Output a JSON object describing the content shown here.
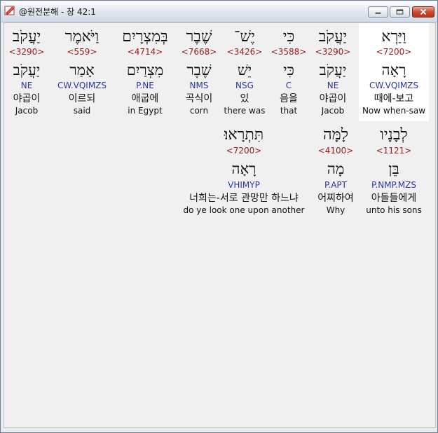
{
  "window": {
    "title": "@원전분해 - 창 42:1",
    "controls": [
      "minimize-icon",
      "maximize-icon",
      "close-icon"
    ]
  },
  "colors": {
    "strong": "#9b1a1a",
    "morph": "#2a36a8",
    "selected_bg": "#ffffff"
  },
  "rows": [
    {
      "words": [
        {
          "hebrew": "וַיַּרְא",
          "strong": "<7200>",
          "root": "רָאָה",
          "morph": "CW.VQIMZS",
          "korean": "때에-보고",
          "english": "Now when-saw",
          "selected": true
        },
        {
          "hebrew": "יַעֲקֹב",
          "strong": "<3290>",
          "root": "יַעֲקֹב",
          "morph": "NE",
          "korean": "야곱이",
          "english": "Jacob"
        },
        {
          "hebrew": "כִּי",
          "strong": "<3588>",
          "root": "כִּי",
          "morph": "C",
          "korean": "음을",
          "english": "that"
        },
        {
          "hebrew": "יֶשׁ־",
          "strong": "<3426>",
          "root": "יֵשׁ",
          "morph": "NSG",
          "korean": "있",
          "english": "there was"
        },
        {
          "hebrew": "שֶׁבֶר",
          "strong": "<7668>",
          "root": "שֶׁבֶר",
          "morph": "NMS",
          "korean": "곡식이",
          "english": "corn"
        },
        {
          "hebrew": "בְּמִצְרָיִם",
          "strong": "<4714>",
          "root": "מִצְרַיִם",
          "morph": "P.NE",
          "korean": "애굽에",
          "english": "in Egypt"
        },
        {
          "hebrew": "וַיֹּאמֶר",
          "strong": "<559>",
          "root": "אָמַר",
          "morph": "CW.VQIMZS",
          "korean": "이르되",
          "english": "said"
        },
        {
          "hebrew": "יַעֲקֹב",
          "strong": "<3290>",
          "root": "יַעֲקֹב",
          "morph": "NE",
          "korean": "야곱이",
          "english": "Jacob"
        }
      ]
    },
    {
      "words": [
        {
          "hebrew": "לְבָנָיו",
          "strong": "<1121>",
          "root": "בֵּן",
          "morph": "P.NMP.MZS",
          "korean": "아들들에게",
          "english": "unto his sons"
        },
        {
          "hebrew": "לָמָּה",
          "strong": "<4100>",
          "root": "מָה",
          "morph": "P.APT",
          "korean": "어찌하여",
          "english": "Why"
        },
        {
          "hebrew": "תִּתְרָאוּ׃",
          "strong": "<7200>",
          "root": "רָאָה",
          "morph": "VHIMYP",
          "korean": "너희는-서로 관망만 하느냐",
          "english": "do ye look one upon another"
        }
      ]
    }
  ]
}
